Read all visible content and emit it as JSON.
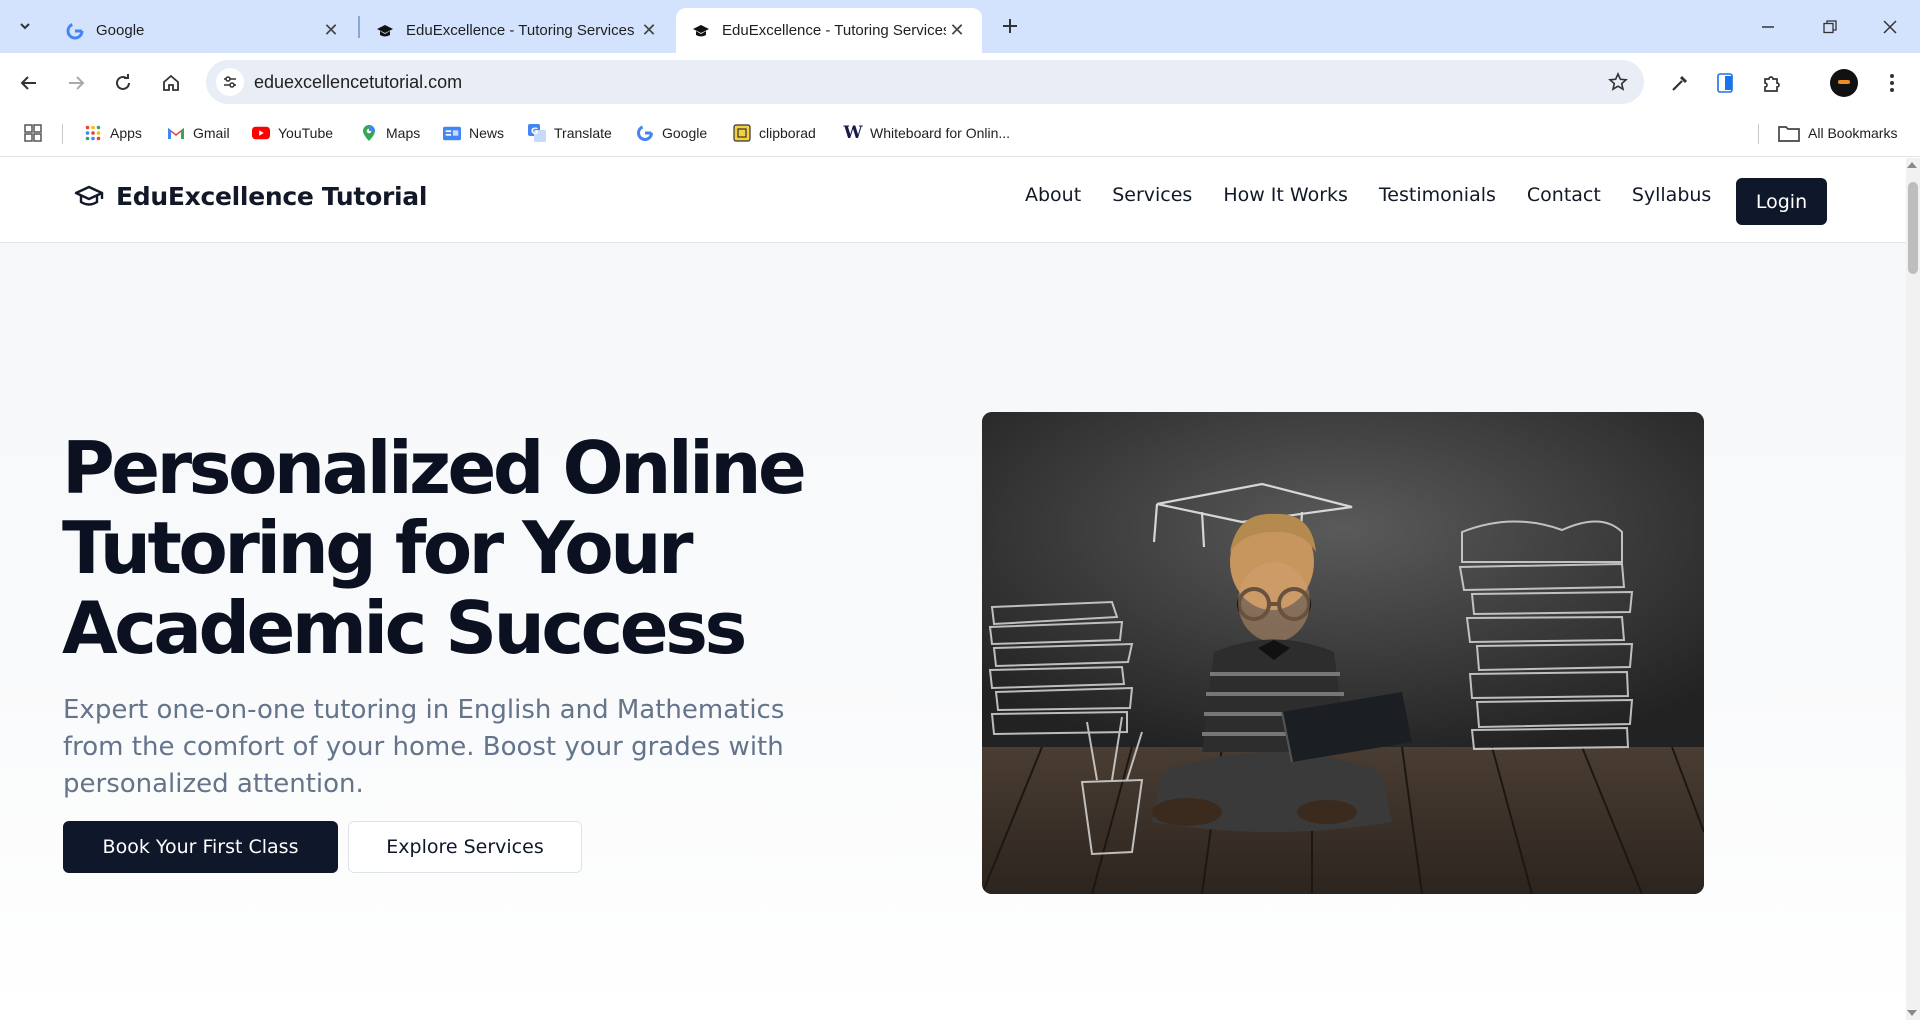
{
  "browser": {
    "tabs": [
      {
        "title": "Google",
        "favicon": "google-favicon",
        "active": false
      },
      {
        "title": "EduExcellence - Tutoring Services",
        "favicon": "graduation-cap-favicon",
        "active": false
      },
      {
        "title": "EduExcellence - Tutoring Services",
        "favicon": "graduation-cap-favicon",
        "active": true
      }
    ],
    "url": "eduexcellencetutorial.com",
    "bookmarks": [
      {
        "label": "Apps",
        "icon": "apps-grid-icon"
      },
      {
        "label": "Gmail",
        "icon": "gmail-icon"
      },
      {
        "label": "YouTube",
        "icon": "youtube-icon"
      },
      {
        "label": "Maps",
        "icon": "maps-pin-icon"
      },
      {
        "label": "News",
        "icon": "news-icon"
      },
      {
        "label": "Translate",
        "icon": "translate-icon"
      },
      {
        "label": "Google",
        "icon": "google-icon"
      },
      {
        "label": "clipborad",
        "icon": "clipboard-icon"
      },
      {
        "label": "Whiteboard for Onlin...",
        "icon": "whiteboard-w-icon"
      }
    ],
    "all_bookmarks_label": "All Bookmarks"
  },
  "site": {
    "brand": "EduExcellence Tutorial",
    "nav": [
      "About",
      "Services",
      "How It Works",
      "Testimonials",
      "Contact",
      "Syllabus"
    ],
    "login_label": "Login",
    "hero": {
      "title_lines": [
        "Personalized Online",
        "Tutoring for Your",
        "Academic Success"
      ],
      "subtitle": "Expert one-on-one tutoring in English and Mathematics from the comfort of your home. Boost your grades with personalized attention.",
      "primary_cta": "Book Your First Class",
      "secondary_cta": "Explore Services",
      "image_alt": "Boy with glasses reading a book on wooden floor in front of chalkboard with graduation cap and book stacks drawings"
    }
  },
  "colors": {
    "tabstrip": "#d3e3fd",
    "brand_dark": "#0f172a",
    "subtitle": "#64748b"
  }
}
